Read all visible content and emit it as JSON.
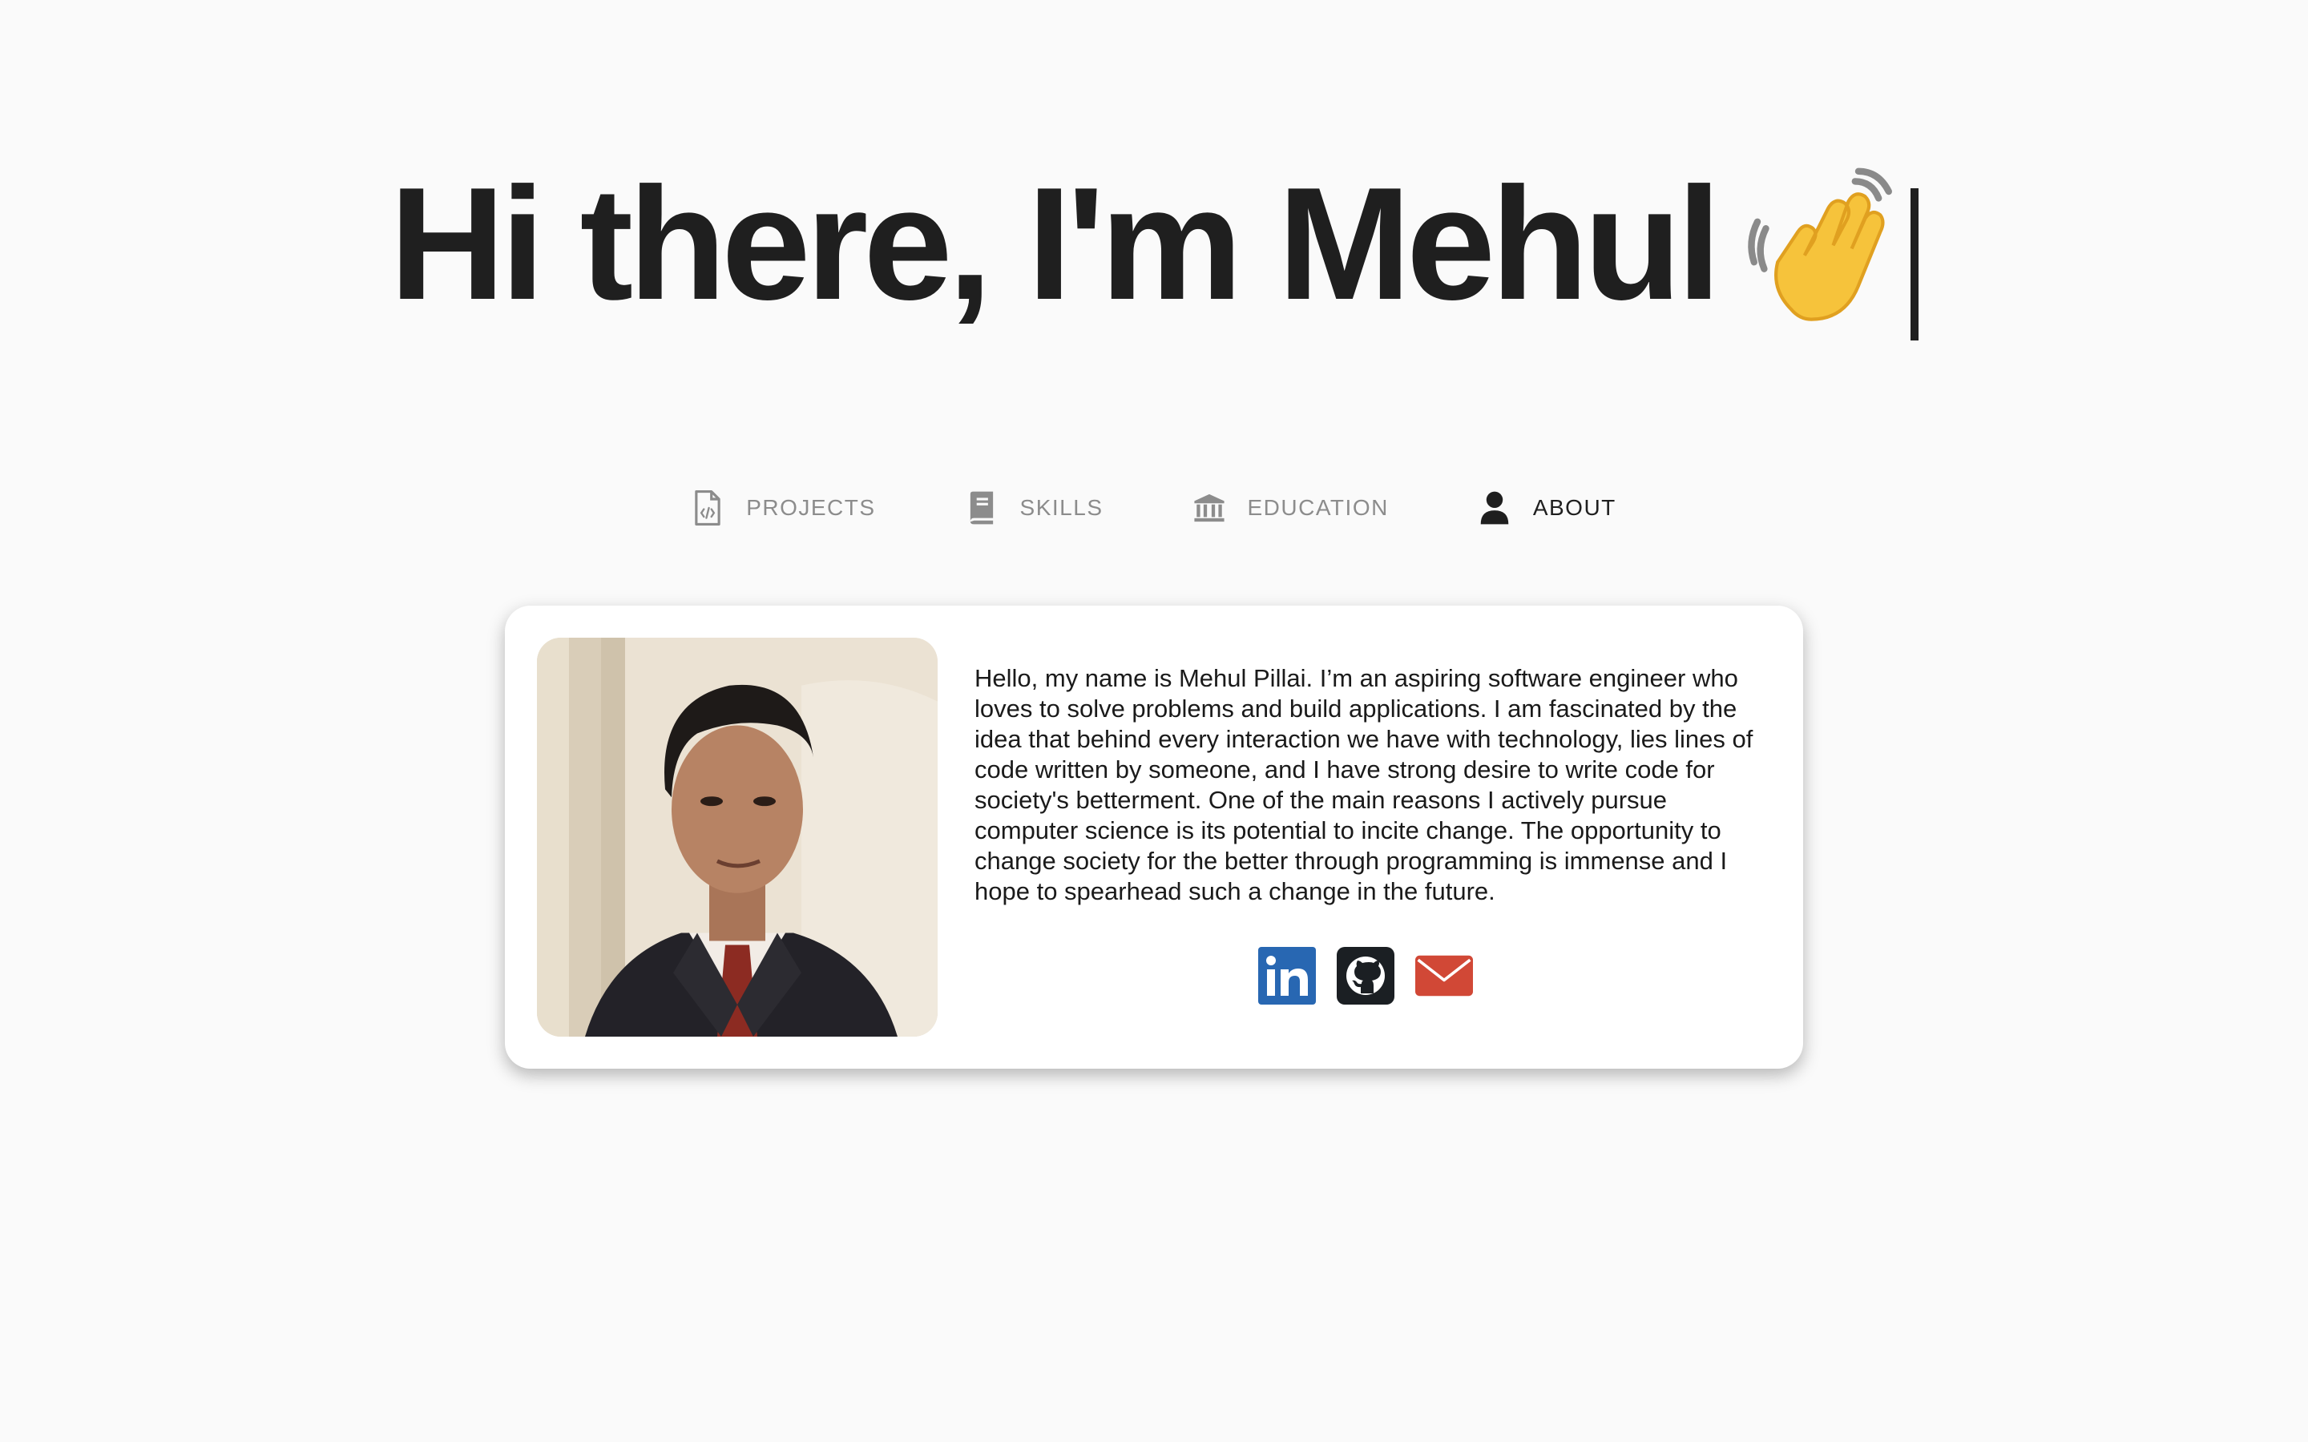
{
  "hero": {
    "title": "Hi there, I'm Mehul",
    "wave_icon": "waving-hand-emoji"
  },
  "tabs": [
    {
      "label": "PROJECTS",
      "icon": "code-file-icon",
      "active": false
    },
    {
      "label": "SKILLS",
      "icon": "book-icon",
      "active": false
    },
    {
      "label": "EDUCATION",
      "icon": "university-icon",
      "active": false
    },
    {
      "label": "ABOUT",
      "icon": "user-icon",
      "active": true
    }
  ],
  "about": {
    "photo_alt": "Portrait of Mehul Pillai",
    "bio": "Hello, my name is Mehul Pillai. I’m an aspiring software engineer who loves to solve problems and build applications. I am fascinated by the idea that behind every interaction we have with technology, lies lines of code written by someone, and I have strong desire to write code for society's betterment. One of the main reasons I actively pursue computer science is its potential to incite change. The opportunity to change society for the better through programming is immense and I hope to spearhead such a change in the future.",
    "socials": [
      {
        "name": "linkedin-icon",
        "color": "#2867b2"
      },
      {
        "name": "github-icon",
        "color": "#1b1f23"
      },
      {
        "name": "email-icon",
        "color": "#d14836"
      }
    ]
  },
  "colors": {
    "background": "#fafafa",
    "text": "#1f1f1f",
    "tab_inactive": "#8c8c8c",
    "card": "#ffffff"
  }
}
